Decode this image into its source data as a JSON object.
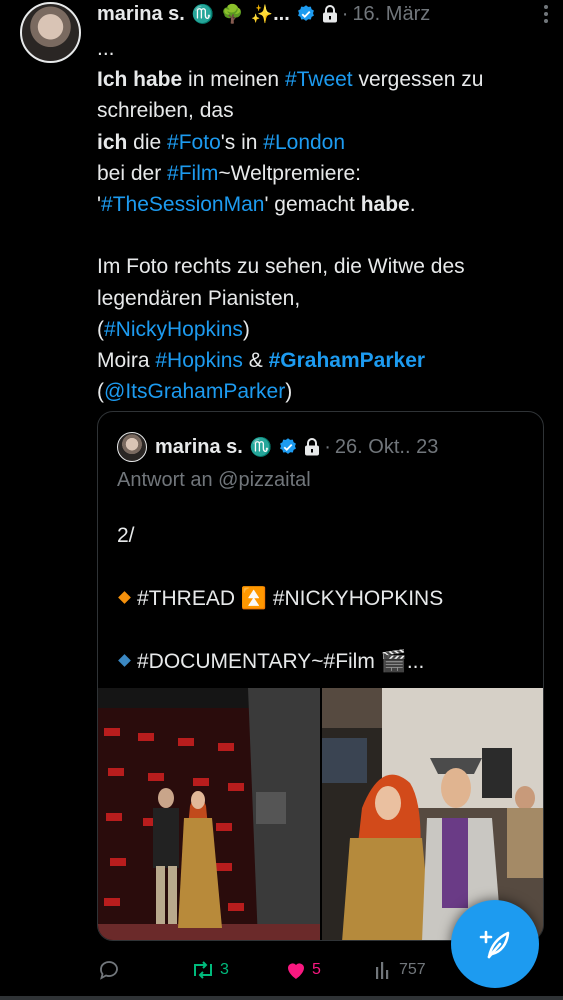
{
  "tweet": {
    "author_name": "marina s.",
    "emojis": [
      "♏",
      "🌳",
      "✨",
      "..."
    ],
    "timestamp": "16. März",
    "separator": "·",
    "text": {
      "ellipsis": "...",
      "l1_b1": "Ich habe",
      "l1_t1": " in meinen ",
      "l1_tag": "#Tweet",
      "l1_t2": " vergessen zu schreiben, das",
      "l2_b1": "ich",
      "l2_t1": " die ",
      "l2_tag1": "#Foto",
      "l2_t2": "'s in ",
      "l2_tag2": "#London",
      "l3_t1": "bei der ",
      "l3_tag": "#Film",
      "l3_t2": "~Weltpremiere:",
      "l4_t1": "'",
      "l4_tag": "#TheSessionMan",
      "l4_t2": "' gemacht ",
      "l4_b1": "habe",
      "l4_t3": ".",
      "p2_t1": "Im Foto rechts zu sehen, die Witwe des legendären Pianisten,",
      "p2_open": "(",
      "p2_tag1": "#NickyHopkins",
      "p2_close": ")",
      "p2_moira": "Moira ",
      "p2_tag2": "#Hopkins",
      "p2_amp": " & ",
      "p2_tag3": "#GrahamParker",
      "p2_open2": "(",
      "p2_mention": "@ItsGrahamParker",
      "p2_close2": ")"
    }
  },
  "quote": {
    "author_name": "marina s.",
    "emoji": "♏",
    "timestamp": "26. Okt.. 23",
    "separator": "·",
    "reply_to": "Antwort an @pizzaital",
    "line1": "2/",
    "line2": "#THREAD ⏫ #NICKYHOPKINS",
    "line3": "#DOCUMENTARY~#Film 🎬..."
  },
  "actions": {
    "reply_count": "",
    "retweet_count": "3",
    "like_count": "5",
    "views_count": "757"
  },
  "colors": {
    "accent": "#1d9bf0",
    "retweet": "#00ba7c",
    "like": "#f91880",
    "muted": "#71767b",
    "text": "#e7e9ea",
    "background": "#000000"
  },
  "icons": [
    "verified-badge-icon",
    "lock-icon",
    "more-icon",
    "reply-icon",
    "retweet-icon",
    "like-icon",
    "views-icon",
    "compose-feather-icon"
  ]
}
